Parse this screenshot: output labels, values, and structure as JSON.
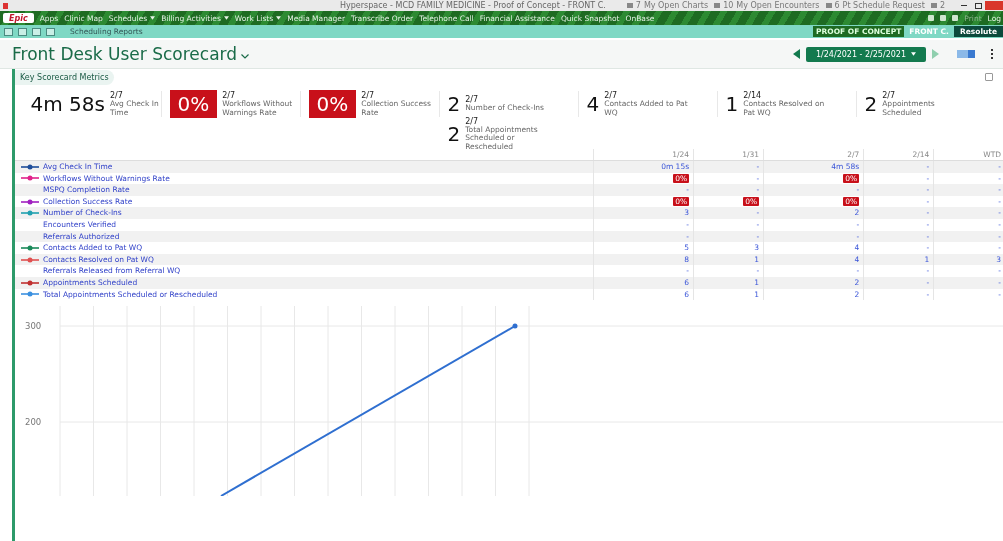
{
  "window": {
    "title": "Hyperspace - MCD FAMILY MEDICINE - Proof of Concept - FRONT C.",
    "notifications": [
      {
        "count": "7",
        "label": "My Open Charts"
      },
      {
        "count": "10",
        "label": "My Open Encounters"
      },
      {
        "count": "6",
        "label": "Pt Schedule Request"
      },
      {
        "count": "2"
      }
    ]
  },
  "menu": {
    "logo": "Epic",
    "items": [
      {
        "label": "Apps",
        "dropdown": false
      },
      {
        "label": "Clinic Map",
        "dropdown": false
      },
      {
        "label": "Schedules",
        "dropdown": true
      },
      {
        "label": "Billing Activities",
        "dropdown": true
      },
      {
        "label": "Work Lists",
        "dropdown": true
      },
      {
        "label": "Media Manager",
        "dropdown": false
      },
      {
        "label": "Transcribe Order",
        "dropdown": false
      },
      {
        "label": "Telephone Call",
        "dropdown": false
      },
      {
        "label": "Financial Assistance",
        "dropdown": false
      },
      {
        "label": "Quick Snapshot",
        "dropdown": false
      },
      {
        "label": "OnBase",
        "dropdown": false
      }
    ],
    "print": "Print",
    "logout": "Log"
  },
  "toolbar": {
    "tab": "Scheduling Reports",
    "environment": "PROOF OF CONCEPT",
    "department": "FRONT C.",
    "app": "Resolute"
  },
  "page": {
    "title": "Front Desk User Scorecard",
    "date_range": "1/24/2021 - 2/25/2021"
  },
  "card": {
    "title": "Key Scorecard Metrics",
    "metrics": [
      {
        "value": "4m 58s",
        "date": "2/7",
        "label": "Avg Check In Time",
        "kind": "plain"
      },
      {
        "value": "0%",
        "date": "2/7",
        "label": "Workflows Without Warnings Rate",
        "kind": "alert"
      },
      {
        "value": "0%",
        "date": "2/7",
        "label": "Collection Success Rate",
        "kind": "alert"
      },
      {
        "value": "2",
        "date": "2/7",
        "label": "Number of Check-Ins",
        "kind": "plain"
      },
      {
        "value": "4",
        "date": "2/7",
        "label": "Contacts Added to Pat WQ",
        "kind": "plain"
      },
      {
        "value": "1",
        "date": "2/14",
        "label": "Contacts Resolved on Pat WQ",
        "kind": "plain"
      },
      {
        "value": "2",
        "date": "2/7",
        "label": "Appointments Scheduled",
        "kind": "plain"
      },
      {
        "value": "2",
        "date": "2/7",
        "label": "Total Appointments Scheduled or Rescheduled",
        "kind": "plain"
      }
    ]
  },
  "table": {
    "columns": [
      "1/24",
      "1/31",
      "2/7",
      "2/14",
      "WTD"
    ],
    "rows": [
      {
        "name": "Avg Check In Time",
        "color": "#1f4e9a",
        "cells": [
          {
            "text": "0m 15s",
            "alert": false
          },
          {
            "text": "-",
            "alert": false
          },
          {
            "text": "4m 58s",
            "alert": false
          },
          {
            "text": "-",
            "alert": false
          },
          {
            "text": "-",
            "alert": false
          }
        ]
      },
      {
        "name": "Workflows Without Warnings Rate",
        "color": "#e0218a",
        "cells": [
          {
            "text": "0%",
            "alert": true
          },
          {
            "text": "-",
            "alert": false
          },
          {
            "text": "0%",
            "alert": true
          },
          {
            "text": "-",
            "alert": false
          },
          {
            "text": "-",
            "alert": false
          }
        ]
      },
      {
        "name": "MSPQ Completion Rate",
        "cells": [
          {
            "text": "-",
            "alert": false
          },
          {
            "text": "-",
            "alert": false
          },
          {
            "text": "-",
            "alert": false
          },
          {
            "text": "-",
            "alert": false
          },
          {
            "text": "-",
            "alert": false
          }
        ]
      },
      {
        "name": "Collection Success Rate",
        "color": "#a020c0",
        "cells": [
          {
            "text": "0%",
            "alert": true
          },
          {
            "text": "0%",
            "alert": true
          },
          {
            "text": "0%",
            "alert": true
          },
          {
            "text": "-",
            "alert": false
          },
          {
            "text": "-",
            "alert": false
          }
        ]
      },
      {
        "name": "Number of Check-Ins",
        "color": "#20a0b0",
        "cells": [
          {
            "text": "3",
            "alert": false
          },
          {
            "text": "-",
            "alert": false
          },
          {
            "text": "2",
            "alert": false
          },
          {
            "text": "-",
            "alert": false
          },
          {
            "text": "-",
            "alert": false
          }
        ]
      },
      {
        "name": "Encounters Verified",
        "cells": [
          {
            "text": "-",
            "alert": false
          },
          {
            "text": "-",
            "alert": false
          },
          {
            "text": "-",
            "alert": false
          },
          {
            "text": "-",
            "alert": false
          },
          {
            "text": "-",
            "alert": false
          }
        ]
      },
      {
        "name": "Referrals Authorized",
        "cells": [
          {
            "text": "-",
            "alert": false
          },
          {
            "text": "-",
            "alert": false
          },
          {
            "text": "-",
            "alert": false
          },
          {
            "text": "-",
            "alert": false
          },
          {
            "text": "-",
            "alert": false
          }
        ]
      },
      {
        "name": "Contacts Added to Pat WQ",
        "color": "#1a8a5a",
        "cells": [
          {
            "text": "5",
            "alert": false
          },
          {
            "text": "3",
            "alert": false
          },
          {
            "text": "4",
            "alert": false
          },
          {
            "text": "-",
            "alert": false
          },
          {
            "text": "-",
            "alert": false
          }
        ]
      },
      {
        "name": "Contacts Resolved on Pat WQ",
        "color": "#e05050",
        "cells": [
          {
            "text": "8",
            "alert": false
          },
          {
            "text": "1",
            "alert": false
          },
          {
            "text": "4",
            "alert": false
          },
          {
            "text": "1",
            "alert": false
          },
          {
            "text": "3",
            "alert": false
          }
        ]
      },
      {
        "name": "Referrals Released from Referral WQ",
        "cells": [
          {
            "text": "-",
            "alert": false
          },
          {
            "text": "-",
            "alert": false
          },
          {
            "text": "-",
            "alert": false
          },
          {
            "text": "-",
            "alert": false
          },
          {
            "text": "-",
            "alert": false
          }
        ]
      },
      {
        "name": "Appointments Scheduled",
        "color": "#c03030",
        "cells": [
          {
            "text": "6",
            "alert": false
          },
          {
            "text": "1",
            "alert": false
          },
          {
            "text": "2",
            "alert": false
          },
          {
            "text": "-",
            "alert": false
          },
          {
            "text": "-",
            "alert": false
          }
        ]
      },
      {
        "name": "Total Appointments Scheduled or Rescheduled",
        "color": "#3a90e0",
        "cells": [
          {
            "text": "6",
            "alert": false
          },
          {
            "text": "1",
            "alert": false
          },
          {
            "text": "2",
            "alert": false
          },
          {
            "text": "-",
            "alert": false
          },
          {
            "text": "-",
            "alert": false
          }
        ]
      }
    ]
  },
  "chart": {
    "kind": "picture",
    "y_axis_labels": [
      "300",
      "200"
    ]
  }
}
